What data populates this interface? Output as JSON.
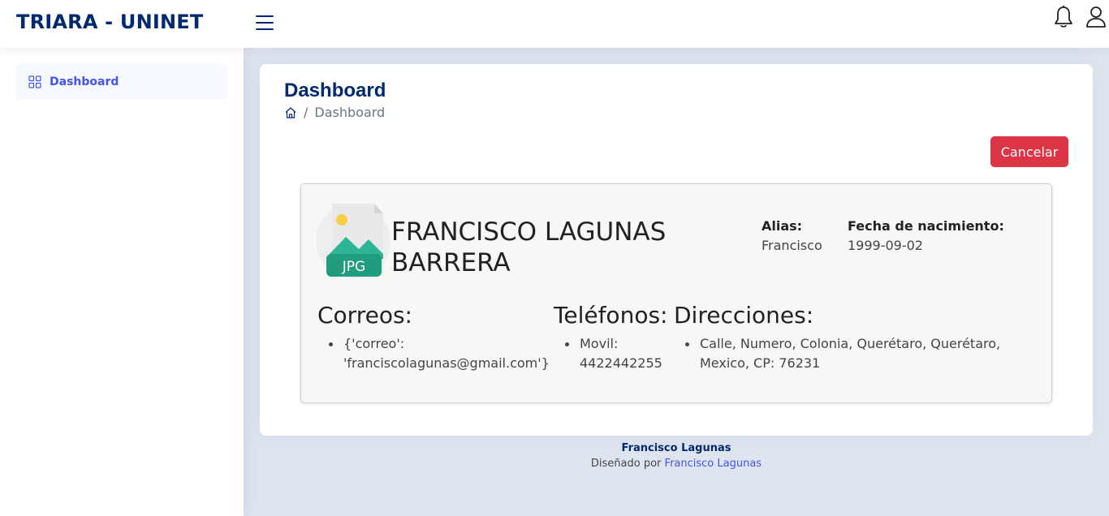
{
  "header": {
    "logo": "TRIARA - UNINET"
  },
  "sidebar": {
    "items": [
      {
        "label": "Dashboard",
        "icon": "grid-icon",
        "active": true
      }
    ]
  },
  "page": {
    "title": "Dashboard",
    "breadcrumb": {
      "current": "Dashboard"
    },
    "cancel_label": "Cancelar"
  },
  "profile": {
    "avatar_text": "JPG",
    "name": "FRANCISCO LAGUNAS BARRERA",
    "alias_label": "Alias:",
    "alias_value": "Francisco",
    "birth_label": "Fecha de nacimiento:",
    "birth_value": "1999-09-02",
    "emails_title": "Correos:",
    "emails": [
      "{'correo': 'franciscolagunas@gmail.com'}"
    ],
    "phones_title": "Teléfonos:",
    "phones": [
      "Movil: 4422442255"
    ],
    "addresses_title": "Direcciones:",
    "addresses": [
      "Calle, Numero, Colonia, Querétaro, Querétaro, Mexico, CP: 76231"
    ]
  },
  "footer": {
    "copyright": "Francisco Lagunas",
    "designed_by": "Diseñado por",
    "designer": "Francisco Lagunas"
  },
  "colors": {
    "brand": "#012970",
    "accent": "#4154f1",
    "danger": "#dc3545",
    "avatar_green": "#2bb594"
  }
}
